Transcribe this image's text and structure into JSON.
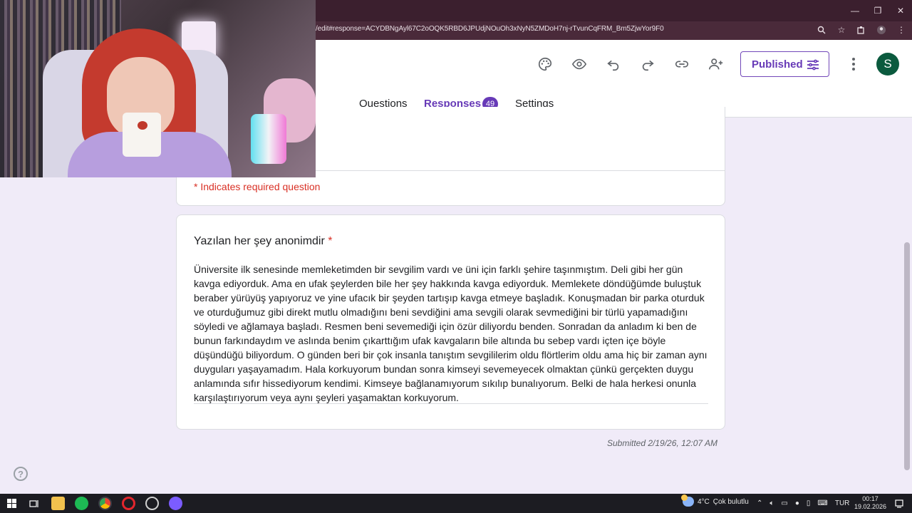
{
  "browser": {
    "url": "/edit#response=ACYDBNgAyl67C2oOQK5RBD6JPUdjNOuOh3xNyN5ZMDoH7nj-rTvunCqFRM_Bm5ZjwYor9F0",
    "window_controls": [
      "—",
      "❐",
      "✕"
    ]
  },
  "header": {
    "published_label": "Published",
    "avatar_letter": "S"
  },
  "tabs": [
    {
      "label": "Questions"
    },
    {
      "label": "Responses",
      "badge": "49"
    },
    {
      "label": "Settings"
    }
  ],
  "form": {
    "required_note": "* Indicates required question",
    "question": {
      "title": "Yazılan her şey anonimdir",
      "required_mark": "*",
      "answer": "Üniversite ilk senesinde memleketimden bir sevgilim vardı ve üni için farklı şehire taşınmıştım. Deli gibi her gün kavga ediyorduk. Ama en ufak şeylerden bile her şey hakkında kavga ediyorduk. Memlekete döndüğümde buluştuk beraber yürüyüş yapıyoruz ve yine ufacık bir şeyden tartışıp kavga etmeye başladık. Konuşmadan bir parka oturduk ve oturduğumuz gibi direkt mutlu olmadığını beni sevdiğini ama sevgili olarak sevmediğini bir türlü yapamadığını söyledi ve ağlamaya başladı. Resmen beni sevemediği için özür diliyordu benden. Sonradan da anladım ki ben de bunun farkındaydım ve aslında benim çıkarttığım ufak kavgaların bile altında bu sebep vardı içten içe böyle düşündüğü biliyordum. O günden beri bir çok insanla tanıştım sevgililerim oldu flörtlerim oldu ama hiç bir zaman aynı duyguları yaşayamadım. Hala korkuyorum bundan sonra kimseyi sevemeyecek olmaktan çünkü gerçekten duygu anlamında sıfır hissediyorum kendimi. Kimseye bağlanamıyorum sıkılıp bunalıyorum. Belki de hala herkesi onunla karşılaştırıyorum veya aynı şeyleri yaşamaktan korkuyorum."
    },
    "submitted": "Submitted 2/19/26, 12:07 AM"
  },
  "help_label": "?",
  "taskbar": {
    "weather_temp": "4°C",
    "weather_text": "Çok bulutlu",
    "language": "TUR",
    "time": "00:17",
    "date": "19.02.2026"
  },
  "colors": {
    "accent": "#673ab7",
    "required": "#d93025",
    "background": "#f0ebf8",
    "avatar": "#0b5a3e"
  }
}
